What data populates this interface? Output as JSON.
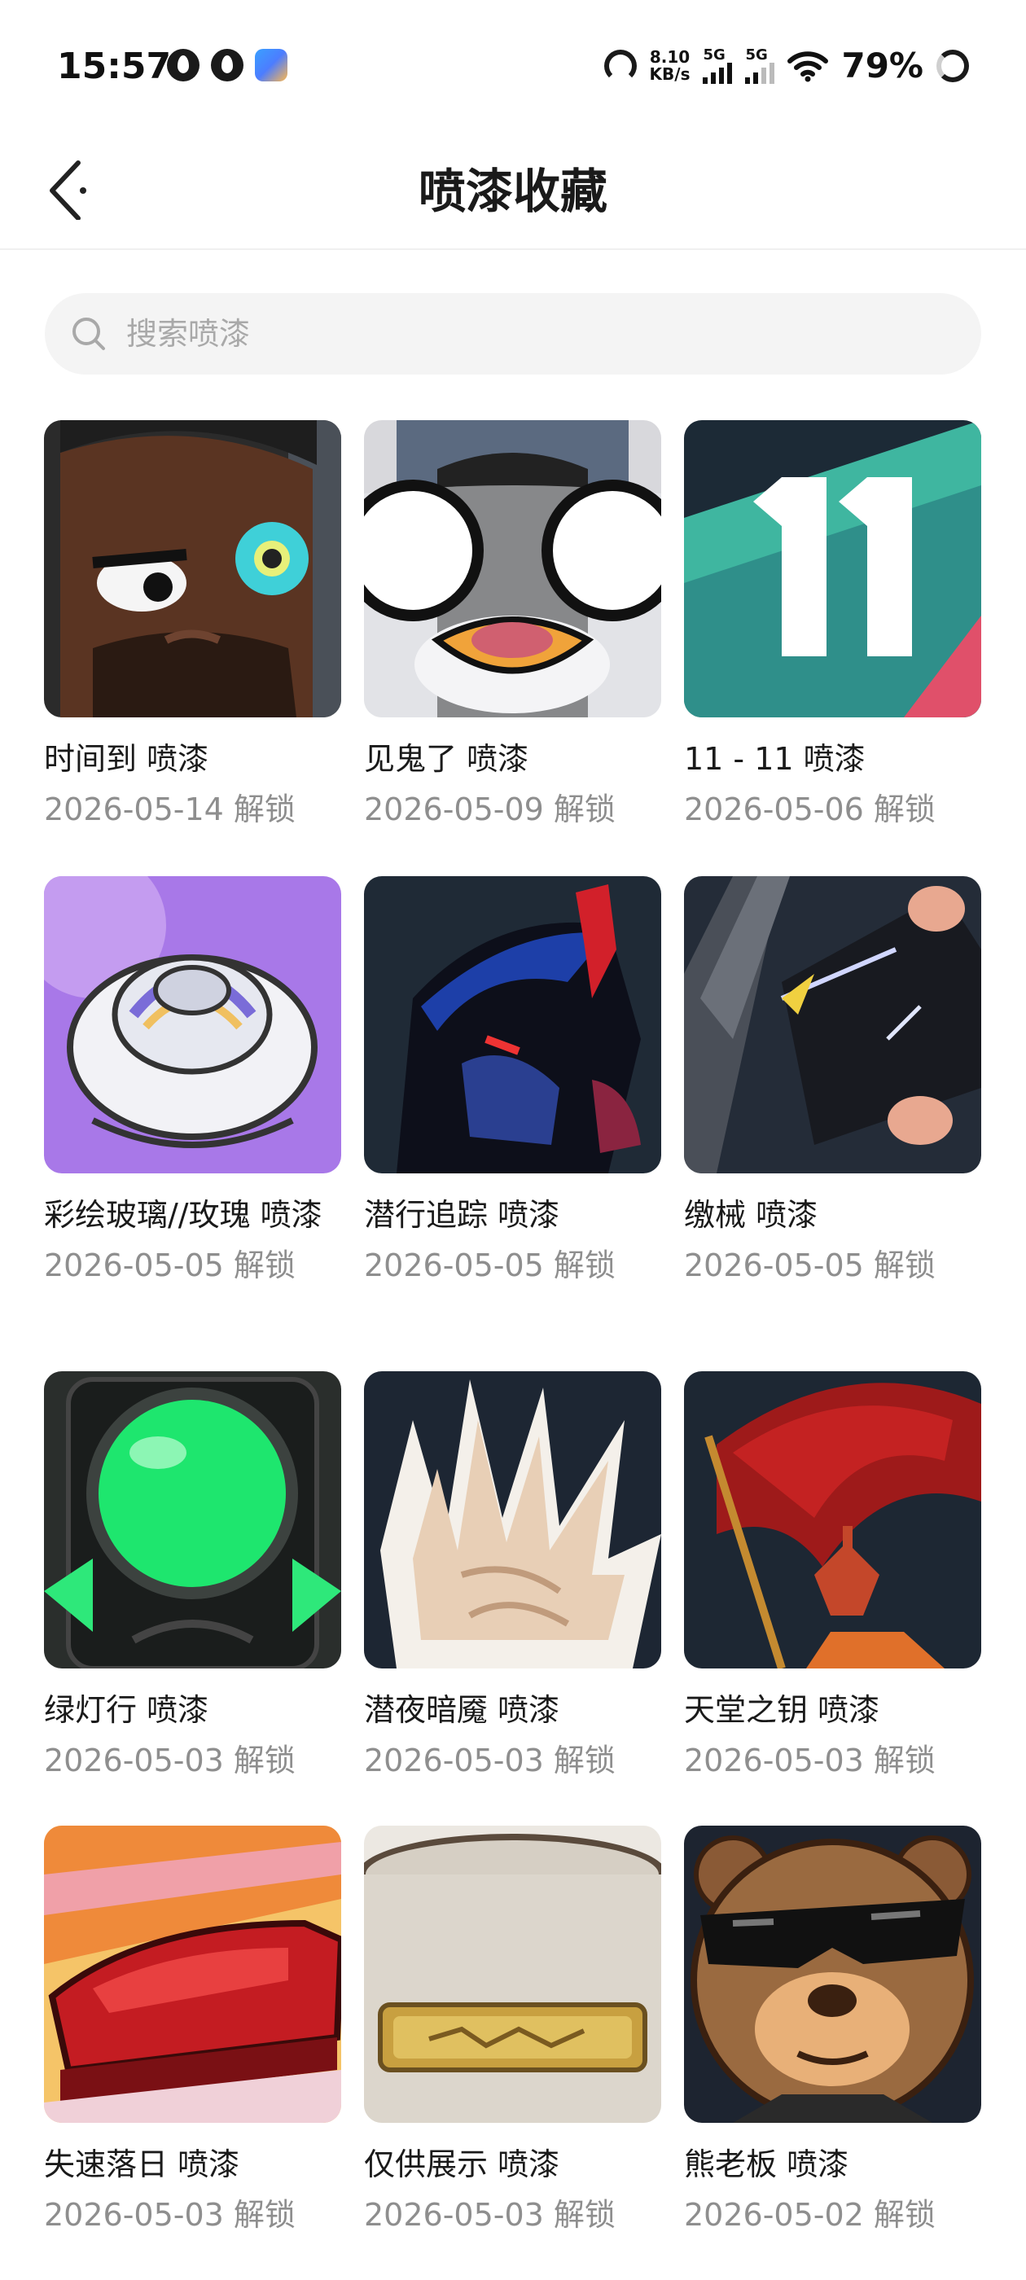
{
  "status_bar": {
    "time": "15:57",
    "speed_value": "8.10",
    "speed_unit": "KB/s",
    "sim1_label": "5G",
    "sim2_label": "5G",
    "battery": "79%"
  },
  "header": {
    "title": "喷漆收藏"
  },
  "search": {
    "placeholder": "搜索喷漆"
  },
  "items": [
    {
      "name": "时间到 喷漆",
      "date": "2026-05-14 解锁",
      "icon": "bearded-man-spray"
    },
    {
      "name": "见鬼了 喷漆",
      "date": "2026-05-09 解锁",
      "icon": "penguin-spray"
    },
    {
      "name": "11 - 11 喷漆",
      "date": "2026-05-06 解锁",
      "icon": "number-11-spray"
    },
    {
      "name": "彩绘玻璃//玫瑰 喷漆",
      "date": "2026-05-05 解锁",
      "icon": "rose-spray"
    },
    {
      "name": "潜行追踪 喷漆",
      "date": "2026-05-05 解锁",
      "icon": "beast-spray"
    },
    {
      "name": "缴械 喷漆",
      "date": "2026-05-05 解锁",
      "icon": "disarm-blade-spray"
    },
    {
      "name": "绿灯行 喷漆",
      "date": "2026-05-03 解锁",
      "icon": "green-light-spray"
    },
    {
      "name": "潜夜暗魇 喷漆",
      "date": "2026-05-03 解锁",
      "icon": "claw-hand-spray"
    },
    {
      "name": "天堂之钥 喷漆",
      "date": "2026-05-03 解锁",
      "icon": "red-flag-spray"
    },
    {
      "name": "失速落日 喷漆",
      "date": "2026-05-03 解锁",
      "icon": "red-car-spray"
    },
    {
      "name": "仅供展示 喷漆",
      "date": "2026-05-03 解锁",
      "icon": "display-plate-spray"
    },
    {
      "name": "熊老板 喷漆",
      "date": "2026-05-02 解锁",
      "icon": "bear-boss-spray"
    }
  ]
}
